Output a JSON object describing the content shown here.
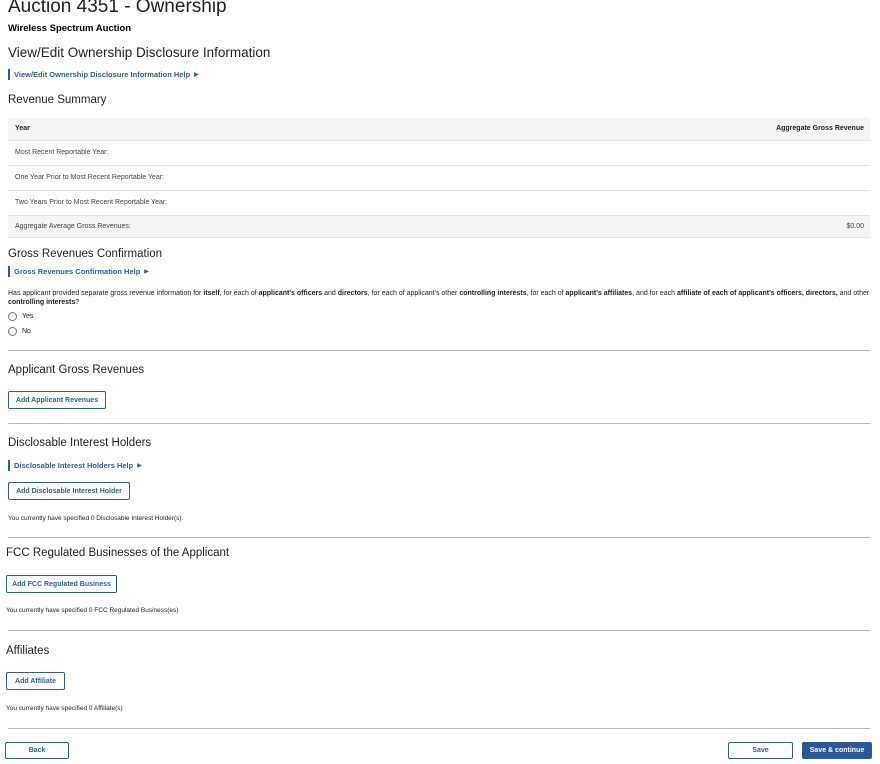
{
  "page": {
    "title": "Auction 4351 - Ownership",
    "subtitle": "Wireless Spectrum Auction",
    "section_title": "View/Edit Ownership Disclosure Information",
    "section_help": "View/Edit Ownership Disclosure Information Help"
  },
  "revenue": {
    "heading": "Revenue Summary",
    "col_year": "Year",
    "col_aggregate": "Aggregate Gross Revenue",
    "rows": [
      {
        "label": "Most Recent Reportable Year:",
        "value": ""
      },
      {
        "label": "One Year Prior to Most Recent Reportable Year:",
        "value": ""
      },
      {
        "label": "Two Years Prior to Most Recent Reportable Year:",
        "value": ""
      }
    ],
    "average_label": "Aggregate Average Gross Revenues:",
    "average_value": "$0.00"
  },
  "confirmation": {
    "heading": "Gross Revenues Confirmation",
    "help": "Gross Revenues Confirmation Help",
    "q": {
      "t1": "Has applicant provided separate gross revenue information for ",
      "b1": "itself",
      "t2": ", for each of ",
      "b2": "applicant's officers",
      "t3": " and ",
      "b3": "directors",
      "t4": ", for each of applicant's other ",
      "b4": "controlling interests",
      "t5": ", for each of ",
      "b5": "applicant's affiliates",
      "t6": ", and for each ",
      "b6": "affiliate of each of applicant's officers, directors,",
      "t7": " and other ",
      "b7": "controlling interests",
      "t8": "?"
    },
    "option_yes": "Yes",
    "option_no": "No"
  },
  "applicant_revenues": {
    "heading": "Applicant Gross Revenues",
    "button": "Add Applicant Revenues"
  },
  "disclosable": {
    "heading": "Disclosable Interest Holders",
    "help": "Disclosable Interest Holders Help",
    "button": "Add Disclosable Interest Holder",
    "note": "You currently have specified 0 Disclosable Interest Holder(s)."
  },
  "fcc": {
    "heading": "FCC Regulated Businesses of the Applicant",
    "button": "Add FCC Regulated Business",
    "note": "You currently have specified 0 FCC Regulated Business(es)"
  },
  "affiliates": {
    "heading": "Affiliates",
    "button": "Add Affiliate",
    "note": "You currently have specified 0 Affiliate(s)"
  },
  "footer": {
    "back": "Back",
    "save": "Save",
    "save_continue": "Save & continue"
  },
  "colors": {
    "link": "#2e5c9a",
    "primary_button": "#2b5797",
    "table_header": "#f3f4f6"
  },
  "icons": {
    "help_arrow": "caret-right-icon"
  }
}
